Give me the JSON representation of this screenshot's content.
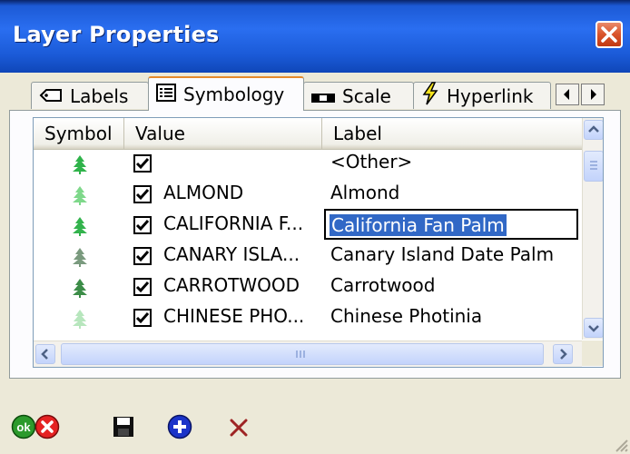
{
  "window": {
    "title": "Layer Properties"
  },
  "tabs": [
    {
      "label": "Labels",
      "icon": "label-tag-icon"
    },
    {
      "label": "Symbology",
      "icon": "list-icon"
    },
    {
      "label": "Scale",
      "icon": "scale-ruler-icon"
    },
    {
      "label": "Hyperlink",
      "icon": "lightning-icon"
    }
  ],
  "list": {
    "columns": [
      "Symbol",
      "Value",
      "Label"
    ],
    "rows": [
      {
        "symbol": "tree-icon",
        "color": "#2fb34a",
        "checked": true,
        "value": "",
        "label": "<Other>"
      },
      {
        "symbol": "tree-icon",
        "color": "#7ed88a",
        "checked": true,
        "value": "ALMOND",
        "label": "Almond"
      },
      {
        "symbol": "tree-icon",
        "color": "#33b34d",
        "checked": true,
        "value": "CALIFORNIA F...",
        "label": "California Fan Palm",
        "editing": true
      },
      {
        "symbol": "tree-icon",
        "color": "#7a9a7e",
        "checked": true,
        "value": "CANARY ISLA...",
        "label": "Canary Island Date Palm"
      },
      {
        "symbol": "tree-icon",
        "color": "#3c8d48",
        "checked": true,
        "value": "CARROTWOOD",
        "label": "Carrotwood"
      },
      {
        "symbol": "tree-icon",
        "color": "#b7e6bd",
        "checked": true,
        "value": "CHINESE PHO...",
        "label": "Chinese Photinia"
      }
    ]
  },
  "toolbar": {
    "ok_label": "ok"
  },
  "colors": {
    "titlebar": "#2a6ef0",
    "selection": "#3168c6",
    "tab_highlight": "#e68b2c"
  }
}
